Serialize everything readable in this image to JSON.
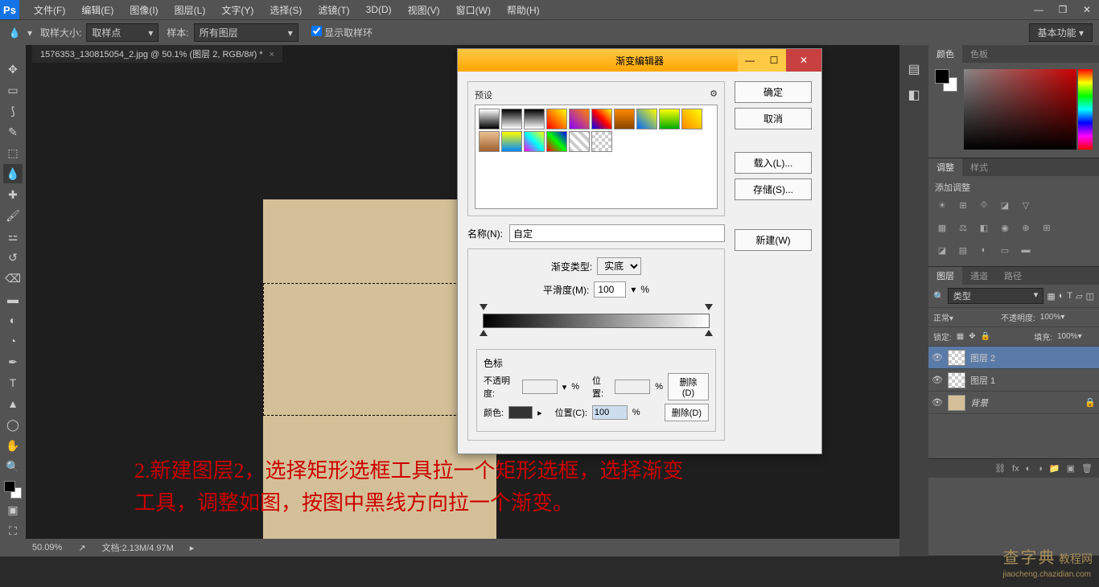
{
  "menu": {
    "logo": "Ps",
    "items": [
      "文件(F)",
      "编辑(E)",
      "图像(I)",
      "图层(L)",
      "文字(Y)",
      "选择(S)",
      "滤镜(T)",
      "3D(D)",
      "视图(V)",
      "窗口(W)",
      "帮助(H)"
    ]
  },
  "win": {
    "min": "—",
    "max": "❐",
    "close": "✕"
  },
  "optbar": {
    "sample_size_label": "取样大小:",
    "sample_size_value": "取样点",
    "sample_label": "样本:",
    "sample_value": "所有图层",
    "show_ring": "显示取样环",
    "basic": "基本功能"
  },
  "doc": {
    "tab": "1576353_130815054_2.jpg @ 50.1% (图层 2, RGB/8#) *",
    "zoom": "50.09%",
    "docinfo": "文档:2.13M/4.97M"
  },
  "annotation": "2.新建图层2，选择矩形选框工具拉一个矩形选框，选择渐变\n工具，调整如图，按图中黑线方向拉一个渐变。",
  "panels": {
    "color_tab": "颜色",
    "swatch_tab": "色板",
    "adjust_tab": "调整",
    "style_tab": "样式",
    "adjust_label": "添加调整",
    "layers_tab": "图层",
    "channels_tab": "通道",
    "paths_tab": "路径",
    "kind": "类型",
    "blend": "正常",
    "opacity_label": "不透明度:",
    "opacity_val": "100%",
    "lock_label": "锁定:",
    "fill_label": "填充:",
    "fill_val": "100%",
    "layers": [
      {
        "name": "图层 2",
        "sel": true,
        "bg": false
      },
      {
        "name": "图层 1",
        "sel": false,
        "bg": false
      },
      {
        "name": "背景",
        "sel": false,
        "bg": true
      }
    ]
  },
  "dialog": {
    "title": "渐变编辑器",
    "presets_label": "预设",
    "gear": "⚙",
    "ok": "确定",
    "cancel": "取消",
    "load": "载入(L)...",
    "save": "存储(S)...",
    "new": "新建(W)",
    "name_label": "名称(N):",
    "name_value": "自定",
    "type_label": "渐变类型:",
    "type_value": "实底",
    "smooth_label": "平滑度(M):",
    "smooth_value": "100",
    "pct": "%",
    "stops_label": "色标",
    "opacity_label": "不透明度:",
    "pos_label": "位置:",
    "pos2_label": "位置(C):",
    "color_label": "颜色:",
    "pos_value": "100",
    "delete": "删除(D)"
  },
  "watermark": {
    "big": "查字典",
    "small": "教程网",
    "url": "jiaocheng.chazidian.com"
  }
}
